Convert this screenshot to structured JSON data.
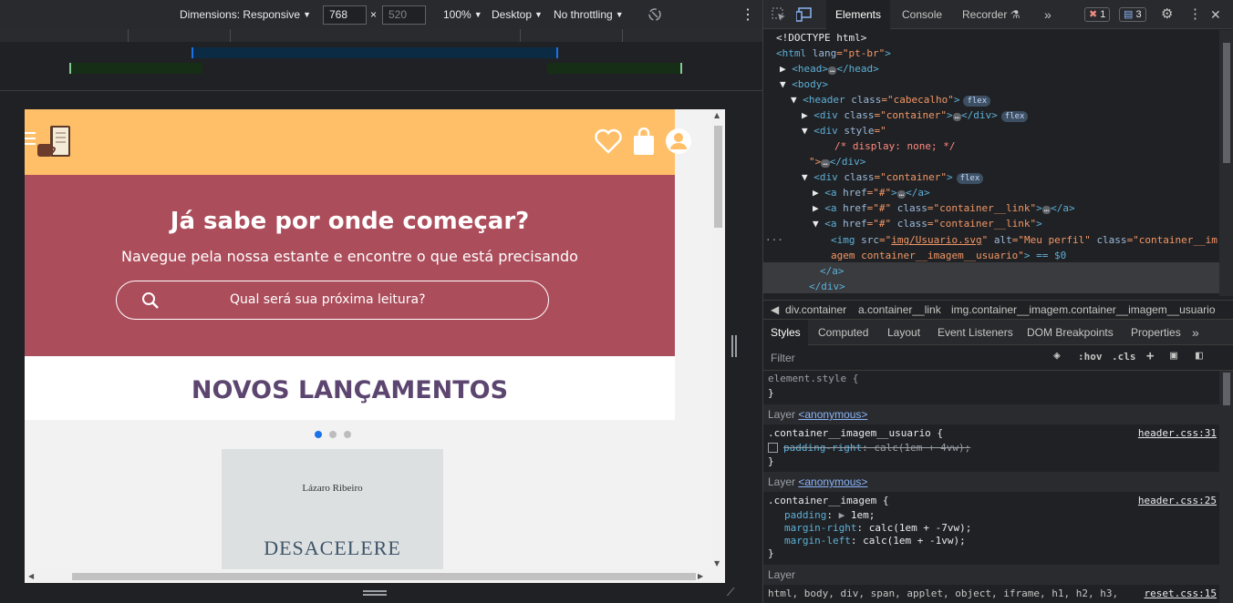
{
  "device_toolbar": {
    "dimensions_label": "Dimensions: Responsive",
    "width": "768",
    "height": "520",
    "times": "×",
    "zoom": "100%",
    "device_type": "Desktop",
    "throttling": "No throttling"
  },
  "site": {
    "hero_title": "Já sabe por onde começar?",
    "hero_subtitle": "Navegue pela nossa estante e encontre o que está precisando",
    "search_placeholder": "Qual será sua próxima leitura?",
    "section_title": "NOVOS LANÇAMENTOS",
    "book_author": "Lázaro Ribeiro",
    "book_title": "DESACELERE"
  },
  "devtools": {
    "tabs": [
      "Elements",
      "Console",
      "Recorder"
    ],
    "active_tab": "Elements",
    "errors_count": "1",
    "messages_count": "3",
    "dom_lines": {
      "l1": "<!DOCTYPE html>",
      "l2a": "<html ",
      "l2b": "lang",
      "l2c": "=\"pt-br\"",
      "l2d": ">",
      "l3": "<head>",
      "l3b": "</head>",
      "l4": "<body>",
      "l5a": "<header ",
      "l5b": "class",
      "l5c": "=\"cabecalho\"",
      "l5d": ">",
      "l6a": "<div ",
      "l6b": "class",
      "l6c": "=\"container\"",
      "l6d": ">",
      "l6e": "</div>",
      "l7a": "<div ",
      "l7b": "style",
      "l7c": "=\"",
      "l8": "/* display: none; */",
      "l9a": "\">",
      "l9b": "</div>",
      "l10a": "<div ",
      "l10b": "class",
      "l10c": "=\"container\"",
      "l10d": ">",
      "l11a": "<a ",
      "l11b": "href",
      "l11c": "=\"#\"",
      "l11d": ">",
      "l11e": "</a>",
      "l12a": "<a ",
      "l12b": "href",
      "l12c": "=\"#\" ",
      "l12d": "class",
      "l12e": "=\"container__link\"",
      "l12f": ">",
      "l12g": "</a>",
      "l13a": "<a ",
      "l13b": "href",
      "l13c": "=\"#\" ",
      "l13d": "class",
      "l13e": "=\"container__link\"",
      "l13f": ">",
      "l14a": "<img ",
      "l14b": "src",
      "l14c": "=\"",
      "l14d": "img/Usuario.svg",
      "l14e": "\" ",
      "l14f": "alt",
      "l14g": "=\"Meu perfil\" ",
      "l14h": "class",
      "l14i": "=\"container__im",
      "l15a": "agem container__imagem__usuario\"",
      "l15b": "> == $0",
      "l16": "</a>",
      "l17": "</div>",
      "flex": "flex",
      "ellipsis": "…",
      "gutter_dots": "···"
    },
    "breadcrumbs": [
      "div.container",
      "a.container__link",
      "img.container__imagem.container__imagem__usuario"
    ],
    "pane_tabs": [
      "Styles",
      "Computed",
      "Layout",
      "Event Listeners",
      "DOM Breakpoints",
      "Properties"
    ],
    "filter_placeholder": "Filter",
    "hov": ":hov",
    "cls": ".cls",
    "styles": {
      "element_style": "element.style {",
      "close": "}",
      "layer_label": "Layer",
      "anonymous": "<anonymous>",
      "rule1_selector": ".container__imagem__usuario {",
      "rule1_source": "header.css:31",
      "rule1_prop": "padding-right",
      "rule1_val": ": calc(1em + 4vw);",
      "rule2_selector": ".container__imagem {",
      "rule2_source": "header.css:25",
      "rule2_p1": "padding",
      "rule2_v1": "1em;",
      "rule2_p2": "margin-right",
      "rule2_v2": ": calc(1em + -7vw);",
      "rule2_p3": "margin-left",
      "rule2_v3": ": calc(1em + -1vw);",
      "reset_selector": "html, body, div, span, applet, object, iframe, h1, h2, h3,",
      "reset_source": "reset.css:15"
    }
  },
  "colors": {
    "header_bg": "#ffbf68",
    "hero_bg": "#ac4d5b",
    "section_title": "#5c4670",
    "active_dot": "#1a73e8"
  }
}
